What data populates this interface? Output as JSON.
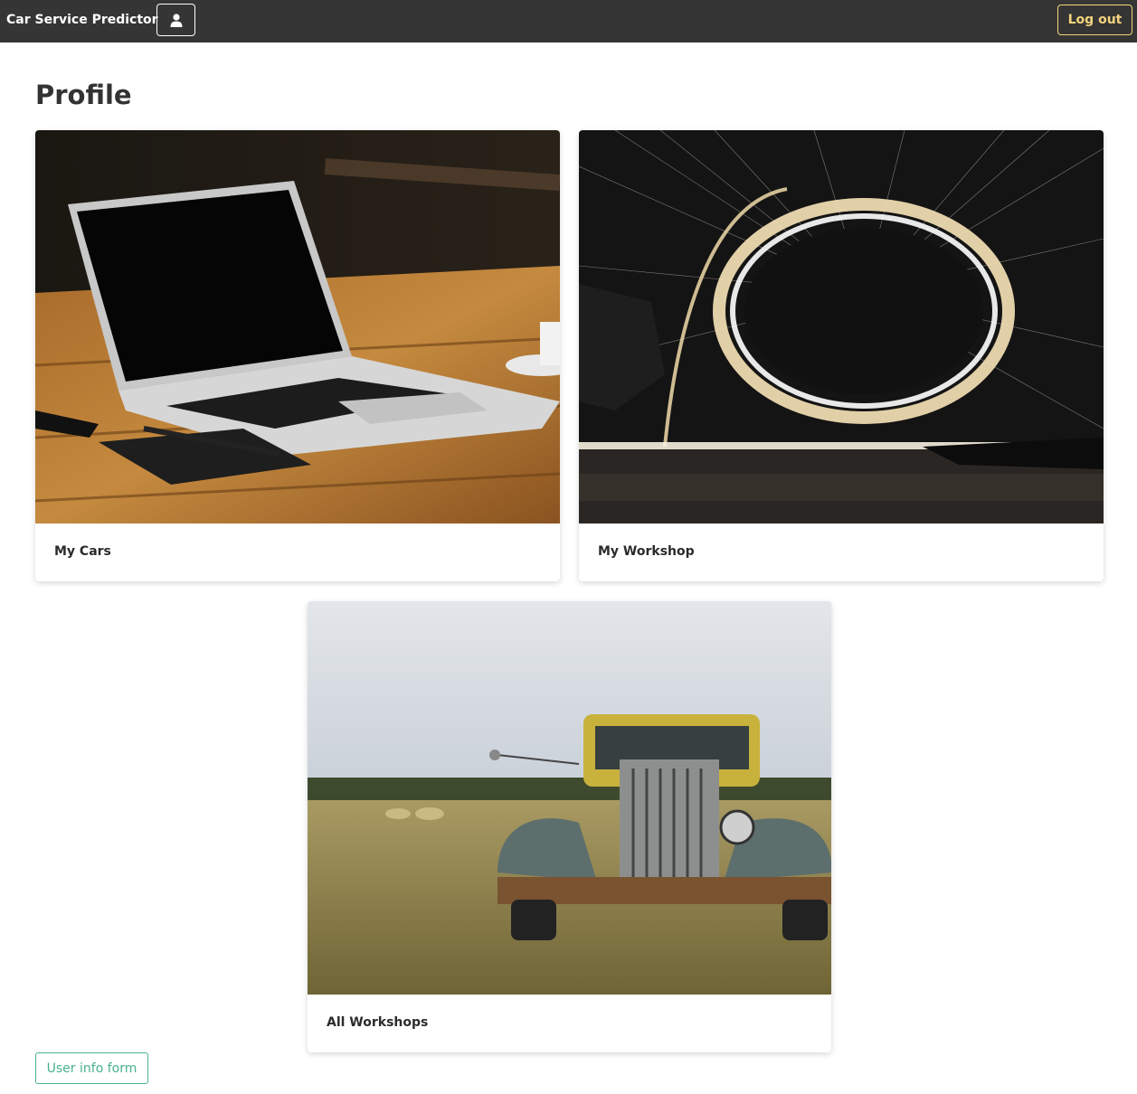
{
  "navbar": {
    "brand": "Car Service Predictor",
    "user_icon": "user-icon",
    "logout_label": "Log out",
    "logout_color": "#f3d47d",
    "background": "#353535"
  },
  "page": {
    "title": "Profile"
  },
  "cards": [
    {
      "label": "My Cars",
      "image": "laptop-on-table-photo"
    },
    {
      "label": "My Workshop",
      "image": "sparks-light-circle-photo"
    },
    {
      "label": "All Workshops",
      "image": "rusty-old-truck-photo"
    }
  ],
  "actions": {
    "user_info_label": "User info form",
    "user_info_color": "#47b28b"
  }
}
